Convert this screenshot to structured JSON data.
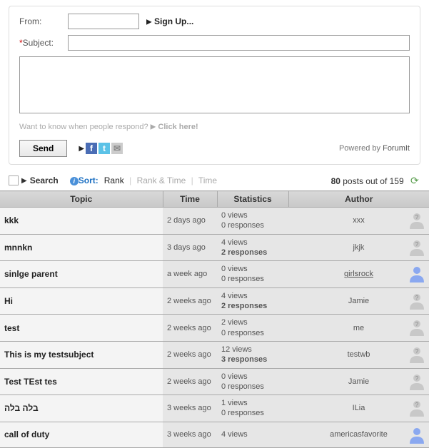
{
  "form": {
    "from_label": "From:",
    "subject_label": "Subject:",
    "signup": "Sign Up...",
    "notify_text": "Want to know when people respond? ",
    "notify_link": "Click here!",
    "send": "Send",
    "powered": "Powered by ",
    "powered_link": "ForumIt"
  },
  "toolbar": {
    "search": "Search",
    "sort_label": "Sort:",
    "sort_rank": "Rank",
    "sort_ranktime": "Rank & Time",
    "sort_time": "Time",
    "count_num": "80",
    "count_text": " posts out of 159"
  },
  "headers": {
    "topic": "Topic",
    "time": "Time",
    "stats": "Statistics",
    "author": "Author"
  },
  "rows": [
    {
      "topic": "kkk",
      "time": "2 days ago",
      "views": "0 views",
      "resp": "0 responses",
      "author": "xxx",
      "rbold": false,
      "link": false,
      "avatar": "gray"
    },
    {
      "topic": "mnnkn",
      "time": "3 days ago",
      "views": "4 views",
      "resp": "2 responses",
      "author": "jkjk",
      "rbold": true,
      "link": false,
      "avatar": "gray"
    },
    {
      "topic": "sinlge parent",
      "time": "a week ago",
      "views": "0 views",
      "resp": "0 responses",
      "author": "girlsrock",
      "rbold": false,
      "link": true,
      "avatar": "blue"
    },
    {
      "topic": "Hi",
      "time": "2 weeks ago",
      "views": "4 views",
      "resp": "2 responses",
      "author": "Jamie",
      "rbold": true,
      "link": false,
      "avatar": "gray"
    },
    {
      "topic": "test",
      "time": "2 weeks ago",
      "views": "2 views",
      "resp": "0 responses",
      "author": "me",
      "rbold": false,
      "link": false,
      "avatar": "gray"
    },
    {
      "topic": "This is my testsubject",
      "time": "2 weeks ago",
      "views": "12 views",
      "resp": "3 responses",
      "author": "testwb",
      "rbold": true,
      "link": false,
      "avatar": "gray"
    },
    {
      "topic": "Test TEst tes",
      "time": "2 weeks ago",
      "views": "0 views",
      "resp": "0 responses",
      "author": "Jamie",
      "rbold": false,
      "link": false,
      "avatar": "gray"
    },
    {
      "topic": "בלה בלה",
      "time": "3 weeks ago",
      "views": "1 views",
      "resp": "0 responses",
      "author": "ILia",
      "rbold": false,
      "link": false,
      "avatar": "gray"
    },
    {
      "topic": "call of duty",
      "time": "3 weeks ago",
      "views": "4 views",
      "resp": "",
      "author": "americasfavorite",
      "rbold": false,
      "link": false,
      "avatar": "blue"
    }
  ]
}
